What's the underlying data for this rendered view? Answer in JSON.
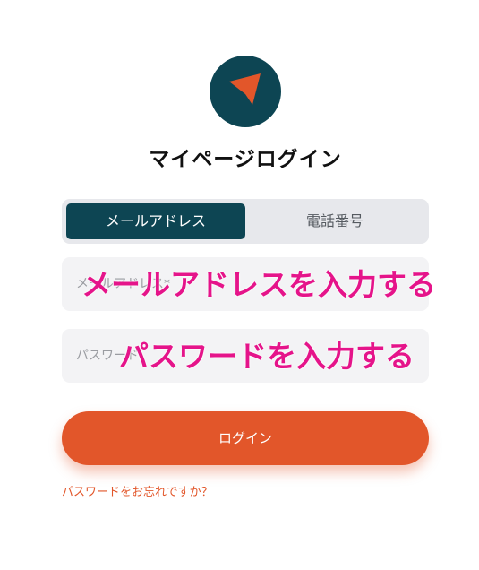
{
  "logo": {
    "icon": "arrow-pointer-icon"
  },
  "title": "マイページログイン",
  "tabs": [
    {
      "label": "メールアドレス",
      "active": true
    },
    {
      "label": "電話番号",
      "active": false
    }
  ],
  "email": {
    "placeholder": "メールアドレス*",
    "overlay": "メールアドレスを入力する"
  },
  "password": {
    "placeholder": "パスワード",
    "overlay": "パスワードを入力する"
  },
  "login_button": "ログイン",
  "forgot_link": "パスワードをお忘れですか？",
  "colors": {
    "brand": "#0d4553",
    "accent": "#e2562a",
    "annotation": "#e5148a"
  }
}
